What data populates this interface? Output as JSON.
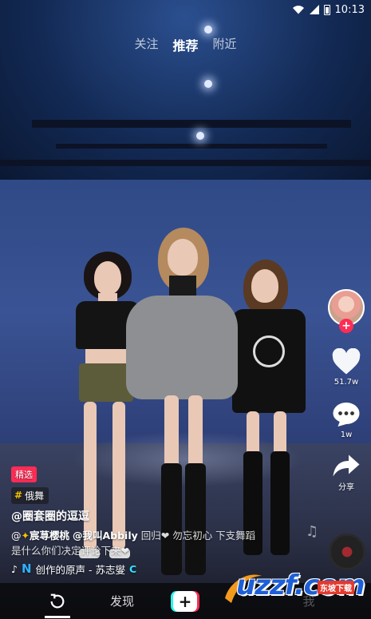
{
  "status_bar": {
    "time": "10:13",
    "icons": [
      "wifi-icon",
      "signal-icon",
      "battery-icon"
    ]
  },
  "top_tabs": [
    {
      "label": "关注",
      "active": false
    },
    {
      "label": "推荐",
      "active": true
    },
    {
      "label": "附近",
      "active": false
    }
  ],
  "rail": {
    "like_count": "51.7w",
    "comment_count": "1w",
    "share_label": "分享"
  },
  "captions": {
    "featured_badge": "精选",
    "topic_tag": "俄舞",
    "author": "@圈套圈的逗逗",
    "desc_prefix": "@",
    "desc_mention_1": "宸荨樱桃",
    "desc_mention_2": "@我叫Abbily",
    "desc_line1_rest": " 回归❤ 勿忘初心 下支舞蹈",
    "desc_line2": "是什么你们决定评论下来❤",
    "music_text": "创作的原声 - 苏志燮"
  },
  "bottom_nav": {
    "refresh_icon": "refresh-icon",
    "discover_label": "发现",
    "plus_label": "+",
    "ghost_label": "我"
  },
  "watermark": {
    "main": "uzzf.com",
    "sub": "东坡下载"
  },
  "colors": {
    "accent_red": "#fe2c55",
    "accent_cyan": "#25f4ee",
    "tag_yellow": "#f7c400"
  }
}
